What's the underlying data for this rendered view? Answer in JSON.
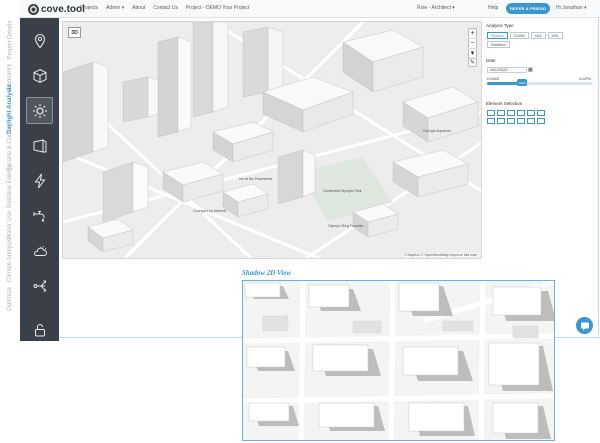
{
  "app": {
    "brand": "cove.tool"
  },
  "topnav": {
    "items": [
      "Projects",
      "Admin ▾",
      "About",
      "Contact Us",
      "Project - DEMO Your Project"
    ],
    "role": "Role - Architect ▾",
    "help": "Help",
    "refer": "REFER A FRIEND",
    "user": "Hi Jonathan ▾"
  },
  "sidebar": {
    "labels": [
      "Project Details",
      "Geometry",
      "Daylight Analysis",
      "Facade & Control",
      "Baseline Energy",
      "Water Use",
      "Climate Analysis",
      "Optimize"
    ],
    "active_index": 2,
    "icons": [
      "location-pin-icon",
      "cube-icon",
      "sun-icon",
      "facade-icon",
      "lightning-icon",
      "water-faucet-icon",
      "cloud-sun-icon",
      "optimize-arrows-icon",
      "lock-icon"
    ]
  },
  "map3d": {
    "btn3d": "3D",
    "zoom_in": "+",
    "zoom_out": "−",
    "compass": "▾",
    "pencil": "✎",
    "attribution": "© Mapbox © OpenStreetMap  Improve this map",
    "labels": [
      "Inn at the Peachtrees",
      "Courtyard by Marriott",
      "Centennial Olympic Park",
      "Olympic Ring Fountain",
      "Georgia Aquarium"
    ]
  },
  "panel": {
    "analysis_type_title": "Analysis Type",
    "tabs": [
      "Shadow",
      "CDA50",
      "sDA",
      "ASE",
      "Radiation"
    ],
    "selected_tab": 0,
    "date_title": "Date",
    "date_value": "06/10/2020",
    "time_start": "6:00AM",
    "time_end": "6:00PM",
    "thumb_label": "10:00",
    "slider_fraction": 0.33,
    "element_title": "Element Selection",
    "element_count": 12
  },
  "shadow2d": {
    "title": "Shadow 2D View"
  },
  "colors": {
    "accent": "#3c97cf",
    "sidebar": "#3a4047",
    "label_inactive": "#a9b6c2"
  }
}
